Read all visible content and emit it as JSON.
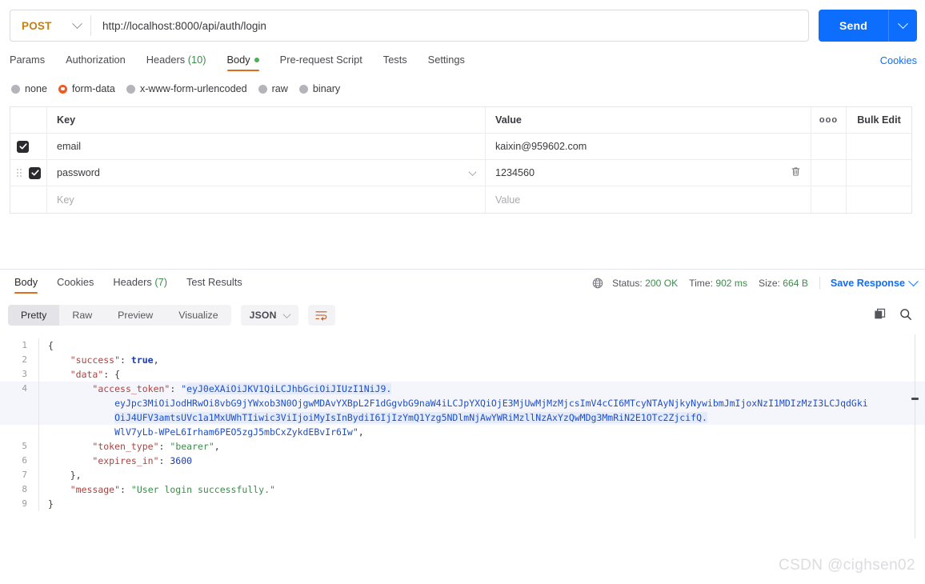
{
  "request": {
    "method": "POST",
    "url": "http://localhost:8000/api/auth/login",
    "send_label": "Send",
    "cookies_label": "Cookies",
    "tabs": [
      {
        "label": "Params",
        "active": false
      },
      {
        "label": "Authorization",
        "active": false
      },
      {
        "label": "Headers",
        "count": "(10)",
        "active": false
      },
      {
        "label": "Body",
        "active": true,
        "dot": true
      },
      {
        "label": "Pre-request Script",
        "active": false
      },
      {
        "label": "Tests",
        "active": false
      },
      {
        "label": "Settings",
        "active": false
      }
    ],
    "body_modes": [
      {
        "label": "none",
        "selected": false
      },
      {
        "label": "form-data",
        "selected": true
      },
      {
        "label": "x-www-form-urlencoded",
        "selected": false
      },
      {
        "label": "raw",
        "selected": false
      },
      {
        "label": "binary",
        "selected": false
      }
    ],
    "table": {
      "headers": {
        "key": "Key",
        "value": "Value",
        "bulk_edit": "Bulk Edit",
        "dots": "ooo"
      },
      "rows": [
        {
          "checked": true,
          "key": "email",
          "value": "kaixin@959602.com",
          "placeholder_row": false
        },
        {
          "checked": true,
          "key": "password",
          "value": "1234560",
          "placeholder_row": false
        },
        {
          "checked": false,
          "key": "Key",
          "value": "Value",
          "placeholder_row": true
        }
      ]
    }
  },
  "response": {
    "tabs": [
      {
        "label": "Body",
        "active": true
      },
      {
        "label": "Cookies",
        "active": false
      },
      {
        "label": "Headers",
        "count": "(7)",
        "active": false
      },
      {
        "label": "Test Results",
        "active": false
      }
    ],
    "status_label": "Status:",
    "status_value": "200 OK",
    "time_label": "Time:",
    "time_value": "902 ms",
    "size_label": "Size:",
    "size_value": "664 B",
    "save_response": "Save Response",
    "format_tabs": [
      {
        "label": "Pretty",
        "active": true
      },
      {
        "label": "Raw",
        "active": false
      },
      {
        "label": "Preview",
        "active": false
      },
      {
        "label": "Visualize",
        "active": false
      }
    ],
    "language": "JSON",
    "body_json": {
      "success": true,
      "data": {
        "access_token_part1": "eyJ0eXAiOiJKV1QiLCJhbGciOiJIUzI1NiJ9.",
        "access_token_part2": "eyJpc3MiOiJodHRwOi8vbG9jYWxob3N0OjgwMDAvYXBpL2F1dGgvbG9naW4iLCJpYXQiOjE3MjUwMjMzMjcsImV4cCI6MTcyNTAyNjkyNywibmJmIjoxNzI1MDIzMzI3LCJqdGki",
        "access_token_part3": "OiJ4UFV3amtsUVc1a1MxUWhTIiwic3ViIjoiMyIsInBydiI6IjIzYmQ1Yzg5NDlmNjAwYWRiMzllNzAxYzQwMDg3MmRiN2E1OTc2ZjcifQ.",
        "access_token_part4": "WlV7yLb-WPeL6Irham6PEO5zgJ5mbCxZykdEBvIr6Iw",
        "token_type": "bearer",
        "expires_in": 3600
      },
      "message": "User login successfully."
    },
    "code_lines": [
      {
        "n": "1",
        "text": "{"
      },
      {
        "n": "2",
        "text": "\"success\": true,"
      },
      {
        "n": "3",
        "text": "\"data\": {"
      },
      {
        "n": "4",
        "text": "\"access_token\": \"...\","
      },
      {
        "n": "5",
        "text": "\"token_type\": \"bearer\","
      },
      {
        "n": "6",
        "text": "\"expires_in\": 3600"
      },
      {
        "n": "7",
        "text": "},"
      },
      {
        "n": "8",
        "text": "\"message\": \"User login successfully.\""
      },
      {
        "n": "9",
        "text": "}"
      }
    ],
    "keys": {
      "success": "success",
      "data": "data",
      "access_token": "access_token",
      "token_type": "token_type",
      "expires_in": "expires_in",
      "message": "message"
    },
    "values": {
      "success": "true",
      "token_type": "bearer",
      "expires_in": "3600",
      "message": "User login successfully."
    }
  },
  "watermark": "CSDN @cighsen02",
  "colors": {
    "accent_blue": "#0d6efd",
    "accent_orange": "#e06c20",
    "method_post": "#c1801a",
    "status_green": "#3d8b4b",
    "token_highlight": "#e4ecfb"
  }
}
